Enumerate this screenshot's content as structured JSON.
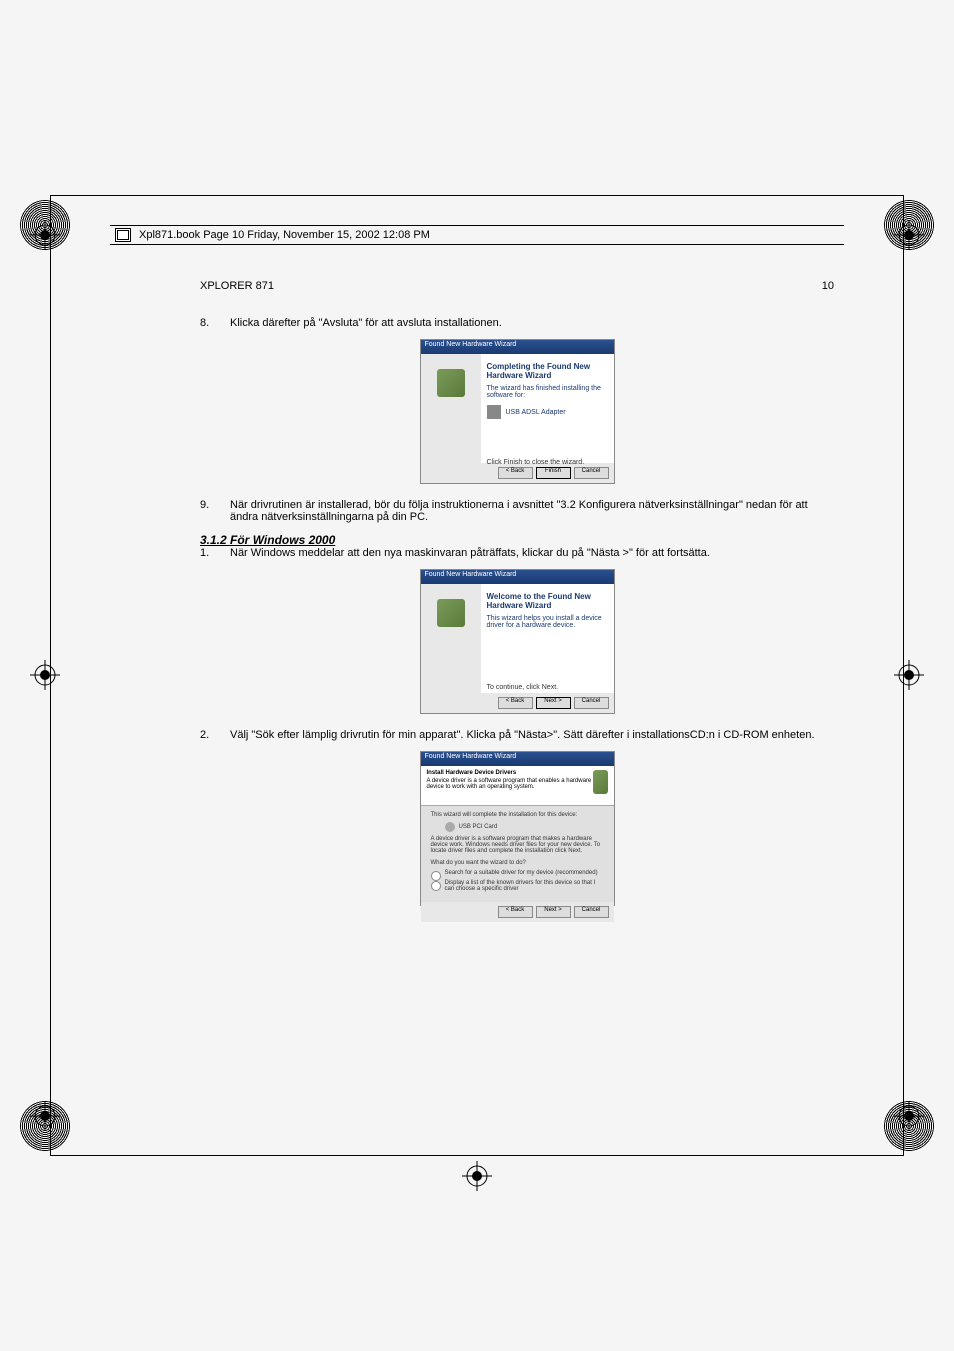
{
  "print_header": "Xpl871.book  Page 10  Friday, November 15, 2002  12:08 PM",
  "doc_title": "XPLORER 871",
  "page_number": "10",
  "item8": {
    "num": "8.",
    "text": "Klicka därefter på \"Avsluta\" för att avsluta installationen."
  },
  "wizard1": {
    "titlebar": "Found New Hardware Wizard",
    "heading": "Completing the Found New Hardware Wizard",
    "body1": "The wizard has finished installing the software for:",
    "body2": "USB ADSL Adapter",
    "body3": "Click Finish to close the wizard.",
    "btn_back": "< Back",
    "btn_finish": "Finish",
    "btn_cancel": "Cancel"
  },
  "item9": {
    "num": "9.",
    "text": "När drivrutinen är installerad, bör du följa instruktionerna i avsnittet \"3.2 Konfigurera nätverksinställningar\" nedan för att ändra nätverksinställningarna på din PC."
  },
  "section_heading": "3.1.2 För Windows 2000",
  "item1": {
    "num": "1.",
    "text": "När Windows meddelar att den nya maskinvaran påträffats, klickar du på \"Nästa >\" för att fortsätta."
  },
  "wizard2": {
    "titlebar": "Found New Hardware Wizard",
    "heading": "Welcome to the Found New Hardware Wizard",
    "body1": "This wizard helps you install a device driver for a hardware device.",
    "body2": "To continue, click Next.",
    "btn_back": "< Back",
    "btn_next": "Next >",
    "btn_cancel": "Cancel"
  },
  "item2": {
    "num": "2.",
    "text": "Välj \"Sök efter lämplig drivrutin för min apparat\". Klicka på \"Nästa>\". Sätt därefter i installationsCD:n i CD-ROM enheten."
  },
  "wizard3": {
    "titlebar": "Found New Hardware Wizard",
    "header_title": "Install Hardware Device Drivers",
    "header_sub": "A device driver is a software program that enables a hardware device to work with an operating system.",
    "body1": "This wizard will complete the installation for this device:",
    "device": "USB PCI Card",
    "body2": "A device driver is a software program that makes a hardware device work. Windows needs driver files for your new device. To locate driver files and complete the installation click Next.",
    "body3": "What do you want the wizard to do?",
    "opt1": "Search for a suitable driver for my device (recommended)",
    "opt2": "Display a list of the known drivers for this device so that I can choose a specific driver",
    "btn_back": "< Back",
    "btn_next": "Next >",
    "btn_cancel": "Cancel"
  }
}
